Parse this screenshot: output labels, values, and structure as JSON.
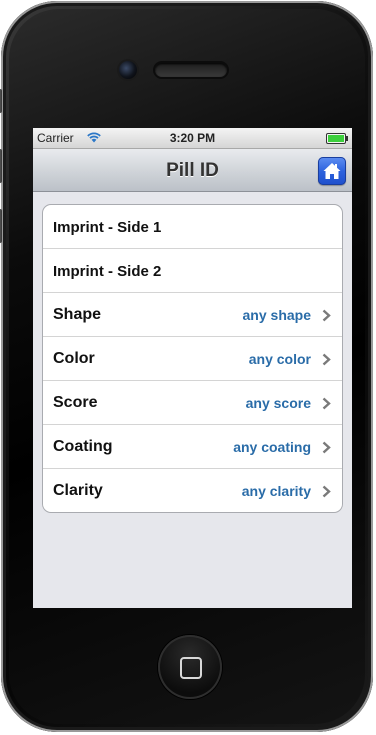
{
  "status_bar": {
    "carrier": "Carrier",
    "time": "3:20 PM",
    "wifi_icon": "wifi-icon",
    "battery_icon": "battery-icon",
    "battery_level": 1.0
  },
  "nav_bar": {
    "title": "Pill ID",
    "home_icon": "home-icon",
    "home_button_color": "#2e63de"
  },
  "form": {
    "imprint_side_1": {
      "label": "Imprint - Side 1"
    },
    "imprint_side_2": {
      "label": "Imprint - Side 2"
    },
    "shape": {
      "label": "Shape",
      "value": "any shape",
      "icon": "chevron-right-icon"
    },
    "color": {
      "label": "Color",
      "value": "any color",
      "icon": "chevron-right-icon"
    },
    "score": {
      "label": "Score",
      "value": "any score",
      "icon": "chevron-right-icon"
    },
    "coating": {
      "label": "Coating",
      "value": "any coating",
      "icon": "chevron-right-icon"
    },
    "clarity": {
      "label": "Clarity",
      "value": "any clarity",
      "icon": "chevron-right-icon"
    }
  },
  "colors": {
    "value_text": "#2a6ca8",
    "background": "#e6e7ec"
  }
}
